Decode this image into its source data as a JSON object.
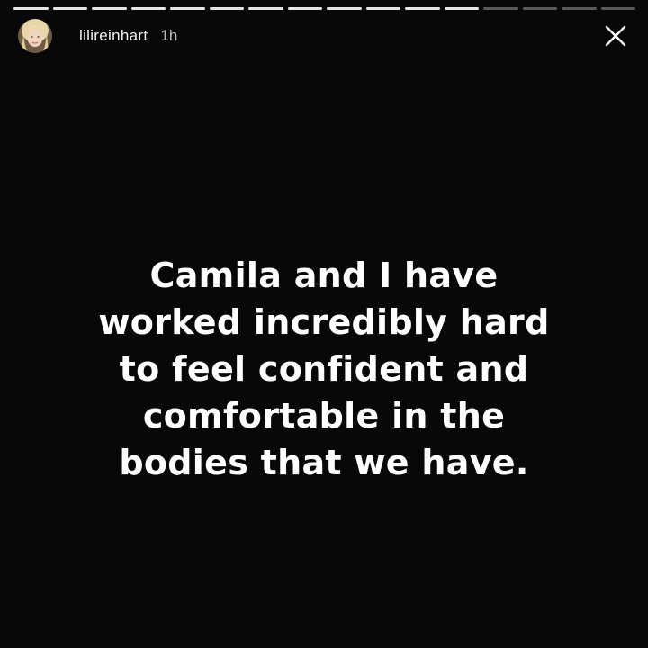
{
  "story": {
    "progress": {
      "segments_total": 16,
      "segments_viewed": 12
    },
    "header": {
      "username": "lilireinhart",
      "time": "1h",
      "avatar_icon": "profile-photo-avatar",
      "close_icon": "close-icon"
    },
    "message": {
      "lines": [
        "Camila and I have",
        "worked incredibly hard",
        "to feel confident and",
        "comfortable in the",
        "bodies that we have."
      ]
    },
    "colors": {
      "background": "#080808",
      "text": "#ffffff",
      "progress_viewed": "#e6e6e6",
      "progress_remaining": "#5a5a5a"
    }
  }
}
